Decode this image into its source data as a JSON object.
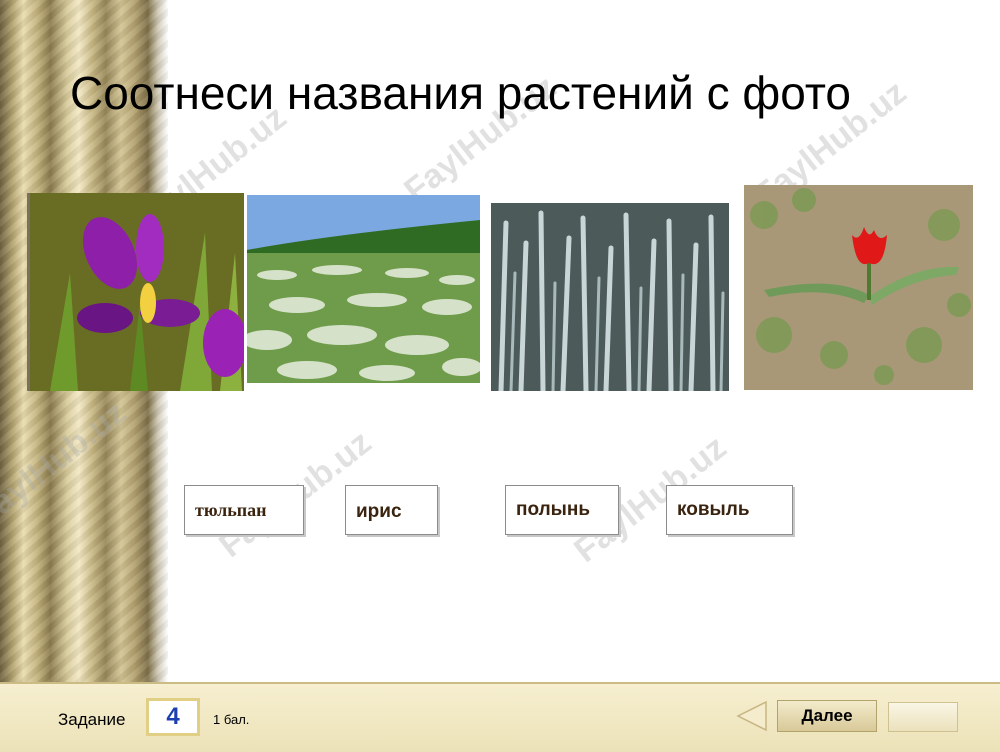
{
  "title": "Соотнеси названия растений с фото",
  "watermark": "FaylHub.uz",
  "photos": [
    {
      "icon": "iris-flower-photo"
    },
    {
      "icon": "feather-grass-field-photo"
    },
    {
      "icon": "wormwood-photo"
    },
    {
      "icon": "red-tulip-photo"
    }
  ],
  "words": [
    "тюльпан",
    "ирис",
    "полынь",
    "ковыль"
  ],
  "footer": {
    "task_label": "Задание",
    "task_number": "4",
    "points": "1 бал.",
    "next_label": "Далее"
  },
  "colors": {
    "accent_gold": "#e0cf84",
    "task_number": "#1b3eb0",
    "word_text": "#3a2410"
  }
}
